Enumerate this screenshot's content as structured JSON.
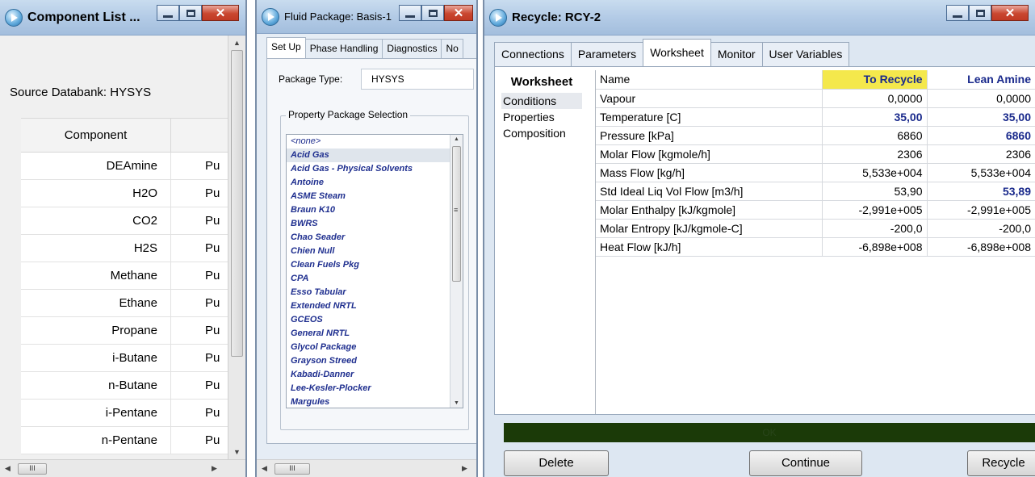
{
  "component_list": {
    "title": "Component List ...",
    "source_databank": "Source Databank: HYSYS",
    "column_header": "Component",
    "rows": [
      {
        "name": "DEAmine",
        "type": "Pu"
      },
      {
        "name": "H2O",
        "type": "Pu"
      },
      {
        "name": "CO2",
        "type": "Pu"
      },
      {
        "name": "H2S",
        "type": "Pu"
      },
      {
        "name": "Methane",
        "type": "Pu"
      },
      {
        "name": "Ethane",
        "type": "Pu"
      },
      {
        "name": "Propane",
        "type": "Pu"
      },
      {
        "name": "i-Butane",
        "type": "Pu"
      },
      {
        "name": "n-Butane",
        "type": "Pu"
      },
      {
        "name": "i-Pentane",
        "type": "Pu"
      },
      {
        "name": "n-Pentane",
        "type": "Pu"
      }
    ],
    "hscroll_label": "III"
  },
  "fluid_package": {
    "title": "Fluid Package: Basis-1",
    "tabs": [
      "Set Up",
      "Phase Handling",
      "Diagnostics",
      "No"
    ],
    "package_type_label": "Package Type:",
    "package_type_value": "HYSYS",
    "selection_label": "Property Package Selection",
    "packages": [
      "<none>",
      "Acid Gas",
      "Acid Gas - Physical Solvents",
      "Antoine",
      "ASME Steam",
      "Braun K10",
      "BWRS",
      "Chao Seader",
      "Chien Null",
      "Clean Fuels Pkg",
      "CPA",
      "Esso Tabular",
      "Extended NRTL",
      "GCEOS",
      "General NRTL",
      "Glycol Package",
      "Grayson Streed",
      "Kabadi-Danner",
      "Lee-Kesler-Plocker",
      "Margules"
    ],
    "hscroll_label": "III"
  },
  "recycle": {
    "title": "Recycle: RCY-2",
    "tabs": [
      "Connections",
      "Parameters",
      "Worksheet",
      "Monitor",
      "User Variables"
    ],
    "nav": {
      "header": "Worksheet",
      "items": [
        "Conditions",
        "Properties",
        "Composition"
      ]
    },
    "grid": {
      "header": {
        "name": "Name",
        "col1": "To Recycle",
        "col2": "Lean Amine"
      },
      "rows": [
        {
          "name": "Vapour",
          "v1": "0,0000",
          "v2": "0,0000"
        },
        {
          "name": "Temperature [C]",
          "v1": "35,00",
          "v2": "35,00"
        },
        {
          "name": "Pressure [kPa]",
          "v1": "6860",
          "v2": "6860"
        },
        {
          "name": "Molar Flow [kgmole/h]",
          "v1": "2306",
          "v2": "2306"
        },
        {
          "name": "Mass Flow [kg/h]",
          "v1": "5,533e+004",
          "v2": "5,533e+004"
        },
        {
          "name": "Std Ideal Liq Vol Flow [m3/h]",
          "v1": "53,90",
          "v2": "53,89"
        },
        {
          "name": "Molar Enthalpy [kJ/kgmole]",
          "v1": "-2,991e+005",
          "v2": "-2,991e+005"
        },
        {
          "name": "Molar Entropy [kJ/kgmole-C]",
          "v1": "-200,0",
          "v2": "-200,0"
        },
        {
          "name": "Heat Flow [kJ/h]",
          "v1": "-6,898e+008",
          "v2": "-6,898e+008"
        }
      ]
    },
    "status": "OK",
    "buttons": {
      "delete": "Delete",
      "continue": "Continue",
      "recycle": "Recycle"
    }
  },
  "colors": {
    "status_bar": "#1b3a08",
    "highlight_header": "#f4e84c",
    "value_blue": "#1a2a8c"
  }
}
